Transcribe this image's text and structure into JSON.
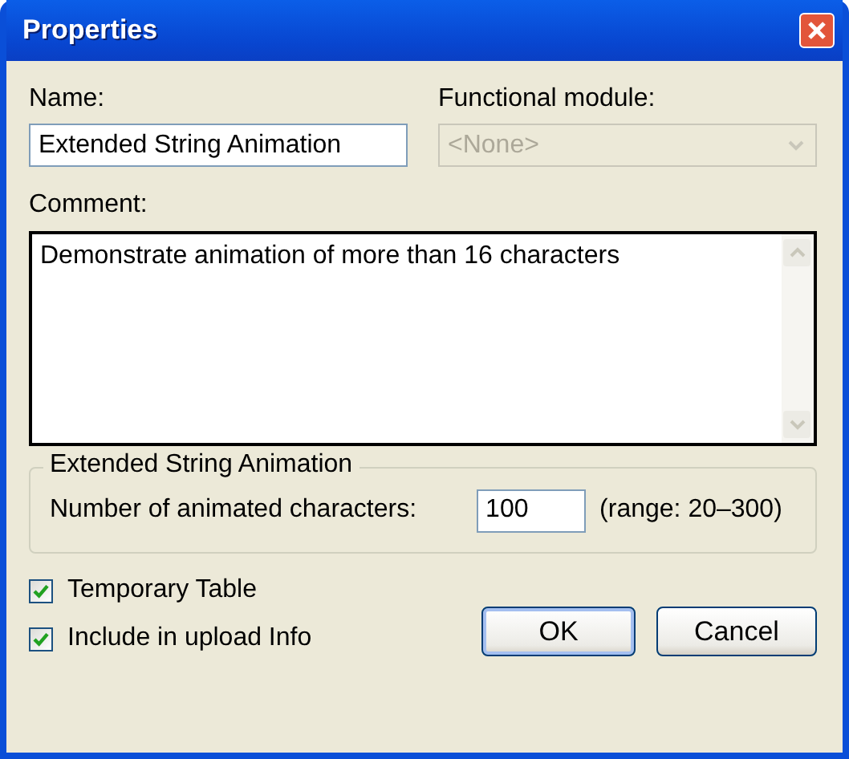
{
  "window": {
    "title": "Properties"
  },
  "name": {
    "label": "Name:",
    "value": "Extended String Animation"
  },
  "functional_module": {
    "label": "Functional module:",
    "value": "<None>",
    "disabled": true
  },
  "comment": {
    "label": "Comment:",
    "value": "Demonstrate animation of more than 16 characters"
  },
  "group": {
    "title": "Extended String Animation",
    "label": "Number of animated characters:",
    "value": "100",
    "range": "(range: 20–300)"
  },
  "checkboxes": [
    {
      "label": "Temporary Table",
      "checked": true
    },
    {
      "label": "Include in upload Info",
      "checked": true
    }
  ],
  "buttons": [
    {
      "label": "OK",
      "default": true
    },
    {
      "label": "Cancel",
      "default": false
    }
  ]
}
